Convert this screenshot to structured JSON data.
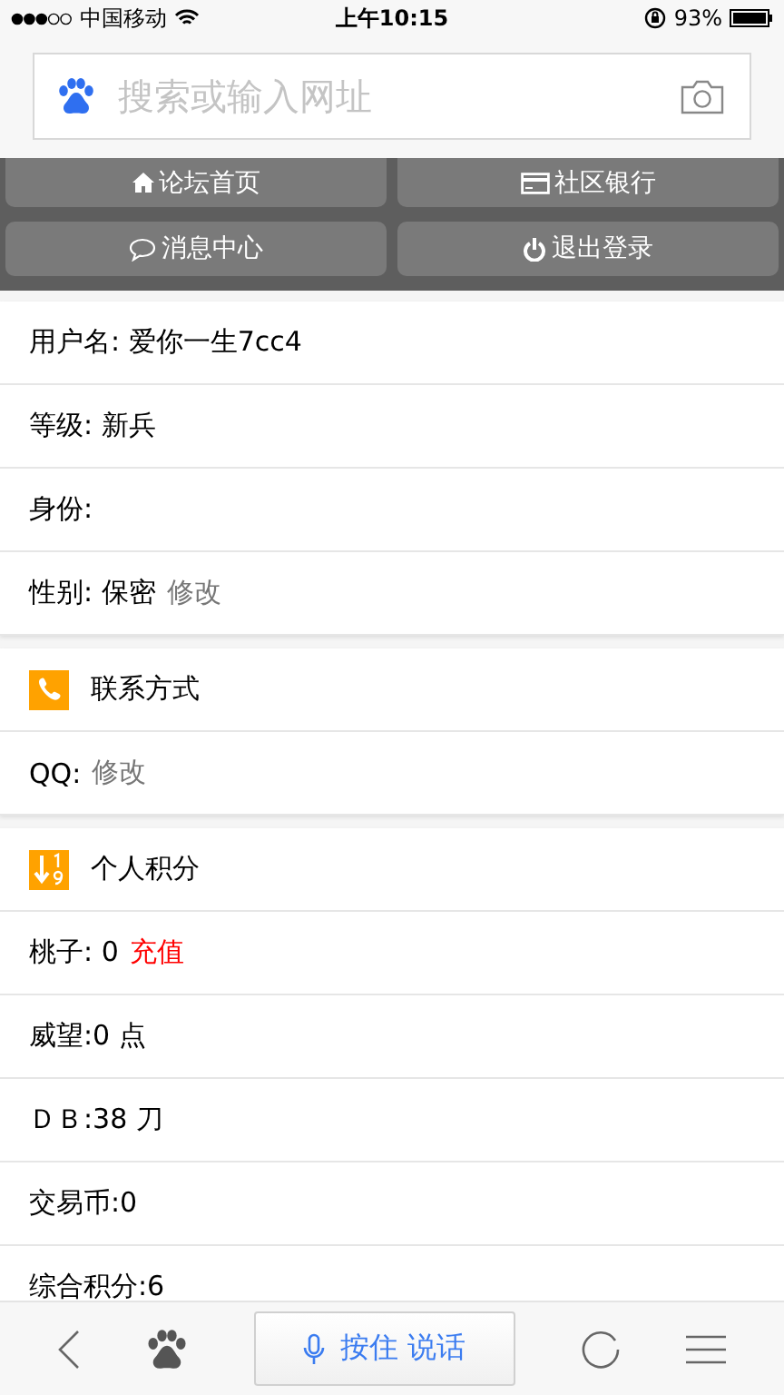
{
  "status_bar": {
    "carrier": "中国移动",
    "time": "上午10:15",
    "battery": "93%"
  },
  "search": {
    "placeholder": "搜索或输入网址"
  },
  "nav_buttons": [
    {
      "label": "论坛首页"
    },
    {
      "label": "社区银行"
    },
    {
      "label": "消息中心"
    },
    {
      "label": "退出登录"
    }
  ],
  "sections": [
    {
      "rows": [
        {
          "kind": "field",
          "text": "用户名: 爱你一生7cc4"
        },
        {
          "kind": "field",
          "text": "等级: 新兵"
        },
        {
          "kind": "field",
          "text": "身份:"
        },
        {
          "kind": "field",
          "text": "性别: 保密",
          "action": {
            "text": "修改",
            "kind": "edit"
          }
        }
      ]
    },
    {
      "header": {
        "title": "联系方式"
      },
      "rows": [
        {
          "kind": "field",
          "text": "QQ:",
          "action": {
            "text": "修改",
            "kind": "edit"
          }
        }
      ]
    },
    {
      "header": {
        "title": "个人积分"
      },
      "rows": [
        {
          "kind": "field",
          "text": "桃子: 0",
          "action": {
            "text": "充值",
            "kind": "recharge"
          }
        },
        {
          "kind": "field",
          "text": "威望:0 点"
        },
        {
          "kind": "field",
          "text": "ＤＢ:38 刀"
        },
        {
          "kind": "field",
          "text": "交易币:0"
        },
        {
          "kind": "field",
          "text": "综合积分:6"
        }
      ]
    }
  ],
  "toolbar": {
    "voice_button": "按住 说话"
  }
}
